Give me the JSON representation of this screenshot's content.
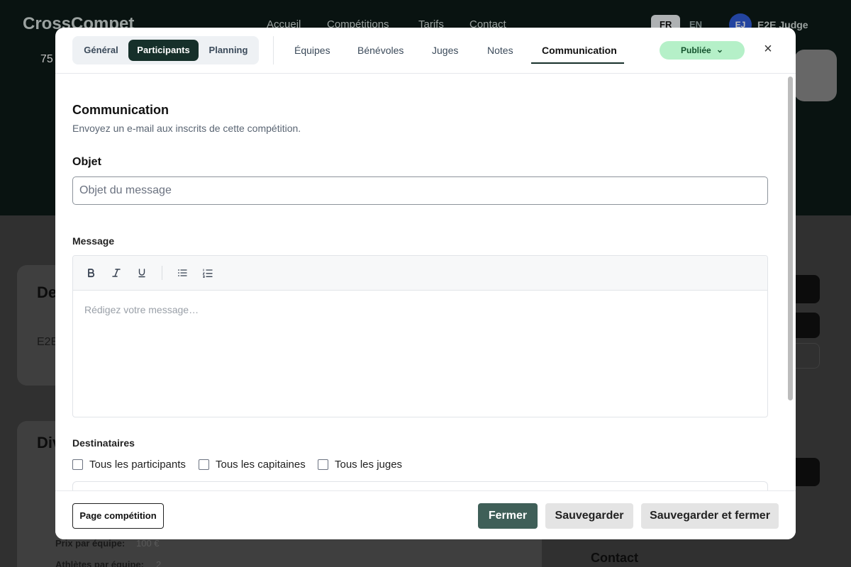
{
  "background": {
    "logo": "CrossCompet",
    "nav": [
      "Accueil",
      "Compétitions",
      "Tarifs",
      "Contact"
    ],
    "lang": [
      "FR",
      "EN"
    ],
    "user_initials": "EJ",
    "user_name": "E2E Judge",
    "frag_75": "75",
    "frag_de": "De",
    "frag_e2e": "E2E",
    "frag_div": "Div",
    "price_label": "Prix par équipe:",
    "price_value": "100 €",
    "athletes_label": "Athlètes par équipe:",
    "athletes_value": "2",
    "contact": "Contact"
  },
  "modal": {
    "segments": [
      {
        "label": "Général",
        "active": false
      },
      {
        "label": "Participants",
        "active": true
      },
      {
        "label": "Planning",
        "active": false
      }
    ],
    "tabs": [
      {
        "label": "Équipes",
        "active": false
      },
      {
        "label": "Bénévoles",
        "active": false
      },
      {
        "label": "Juges",
        "active": false
      },
      {
        "label": "Notes",
        "active": false
      },
      {
        "label": "Communication",
        "active": true
      }
    ],
    "status": {
      "label": "Publiée",
      "color": "#b5f0c8"
    },
    "close_glyph": "×",
    "section_title": "Communication",
    "section_subtitle": "Envoyez un e-mail aux inscrits de cette compétition.",
    "subject_label": "Objet",
    "subject_placeholder": "Objet du message",
    "subject_value": "",
    "message_label": "Message",
    "toolbar_icons": [
      "bold-icon",
      "italic-icon",
      "underline-icon",
      "bullet-list-icon",
      "numbered-list-icon"
    ],
    "message_placeholder": "Rédigez votre message…",
    "recipients_label": "Destinataires",
    "recipients": [
      {
        "label": "Tous les participants",
        "checked": false
      },
      {
        "label": "Tous les capitaines",
        "checked": false
      },
      {
        "label": "Tous les juges",
        "checked": false
      }
    ],
    "footer": {
      "page_button": "Page compétition",
      "close_button": "Fermer",
      "save_button": "Sauvegarder",
      "save_close_button": "Sauvegarder et fermer"
    }
  },
  "colors": {
    "accent_dark": "#16302a",
    "close_button_bg": "#3f5f58",
    "status_green": "#b5f0c8"
  }
}
